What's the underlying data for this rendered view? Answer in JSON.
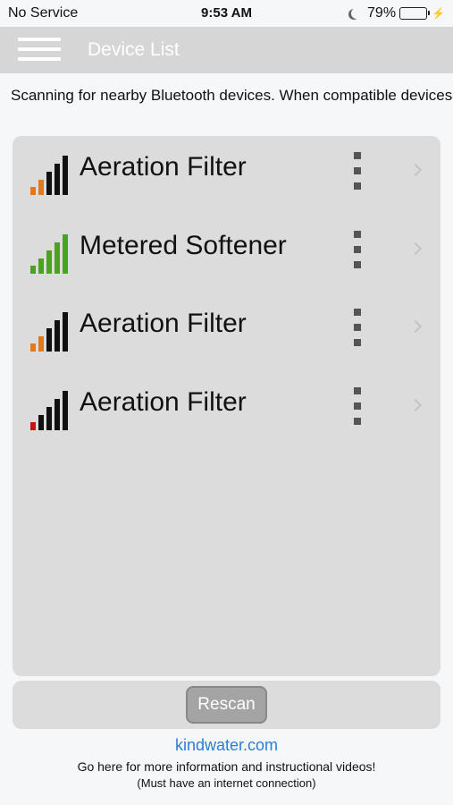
{
  "status_bar": {
    "carrier": "No Service",
    "time": "9:53 AM",
    "battery": "79%",
    "battery_level": 0.79,
    "moon_icon": "moon-icon",
    "charging_icon": "bolt-icon"
  },
  "nav": {
    "title": "Device List",
    "menu_icon": "hamburger-icon"
  },
  "notice": "Scanning for nearby Bluetooth devices. When compatible devices are found they will appear in the list below. Pleas...",
  "devices": [
    {
      "name": "Aeration Filter",
      "signal_bars": 2,
      "signal_color": "#e07a1c"
    },
    {
      "name": "Metered Softener",
      "signal_bars": 5,
      "signal_color": "#4aa21e"
    },
    {
      "name": "Aeration Filter",
      "signal_bars": 2,
      "signal_color": "#e07a1c"
    },
    {
      "name": "Aeration Filter",
      "signal_bars": 1,
      "signal_color": "#c41414"
    }
  ],
  "rescan_label": "Rescan",
  "footer": {
    "link": "kindwater.com",
    "info": "Go here for more information and instructional videos!",
    "note": "(Must have an internet connection)"
  },
  "colors": {
    "nav_background": "#d6d6d6",
    "list_background": "#dcdcdc",
    "link": "#2b7dd6",
    "inactive_bar": "#111111"
  }
}
